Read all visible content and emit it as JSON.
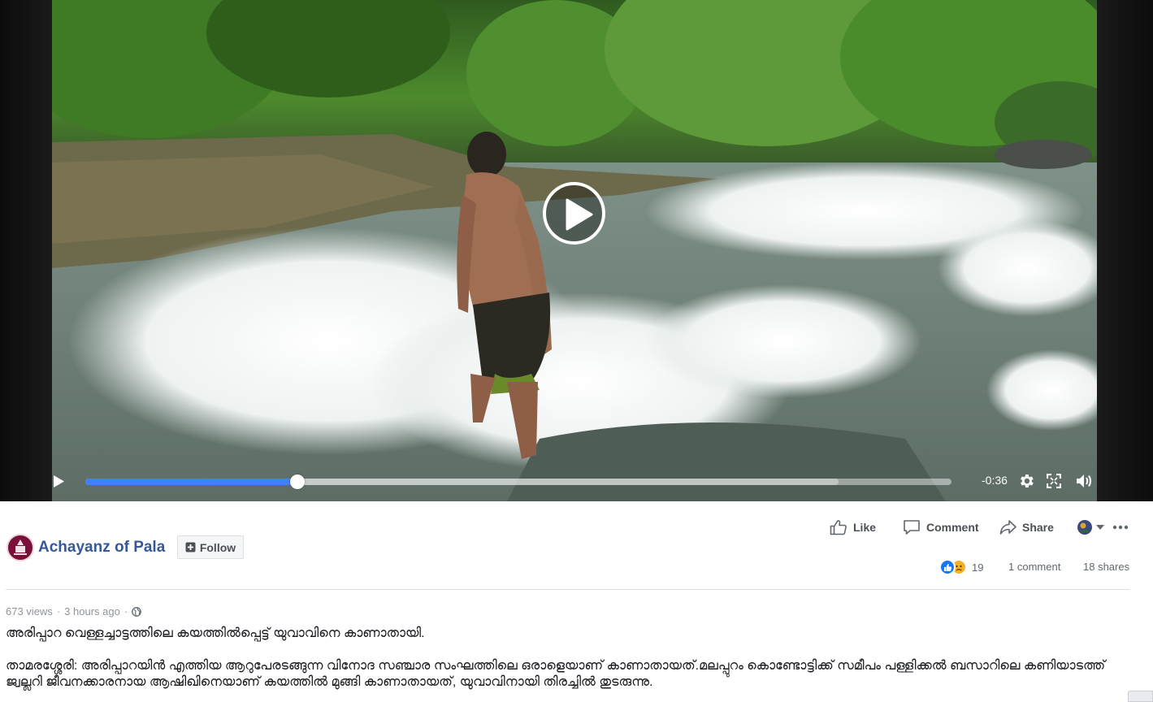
{
  "video": {
    "time_remaining": "-0:36",
    "progress_played": 0.245,
    "progress_buffered": 0.87,
    "icons": {
      "play": "play-icon",
      "big_play": "play-circle-icon",
      "settings": "gear-icon",
      "fullscreen": "fullscreen-icon",
      "volume": "volume-icon"
    }
  },
  "post": {
    "page_name": "Achayanz of Pala",
    "follow_label": "Follow",
    "actions": {
      "like": "Like",
      "comment": "Comment",
      "share": "Share"
    },
    "reaction_count": "19",
    "comments": "1 comment",
    "shares": "18 shares",
    "views": "673 views",
    "separator": "·",
    "time_ago": "3 hours ago",
    "headline": "അരിപ്പാറ വെള്ളച്ചാട്ടത്തിലെ കയത്തിൽപ്പെട്ട് യുവാവിനെ കാണാതായി.",
    "body": "താമരശ്ശേരി: അരിപ്പാറയിൻ എത്തിയ ആറുപേരടങ്ങുന്ന വിനോദ സഞ്ചാര സംഘത്തിലെ ഒരാളെയാണ് കാണാതായത്.മലപ്പുറം കൊണ്ടോട്ടിക്ക് സമീപം പള്ളിക്കൽ ബസാറിലെ കണിയാടത്ത് ജ്വല്ലറി ജീവനക്കാരനായ ആഷിഖിനെയാണ് കയത്തിൽ മുങ്ങി കാണാതായത്, യുവാവിനായി തിരച്ചിൽ തുടരുന്നു."
  },
  "colors": {
    "link_blue": "#365899",
    "progress_blue": "#4080ff",
    "like_blue": "#1877f2",
    "sad_yellow": "#f7b125",
    "page_avatar": "#7a1038"
  }
}
